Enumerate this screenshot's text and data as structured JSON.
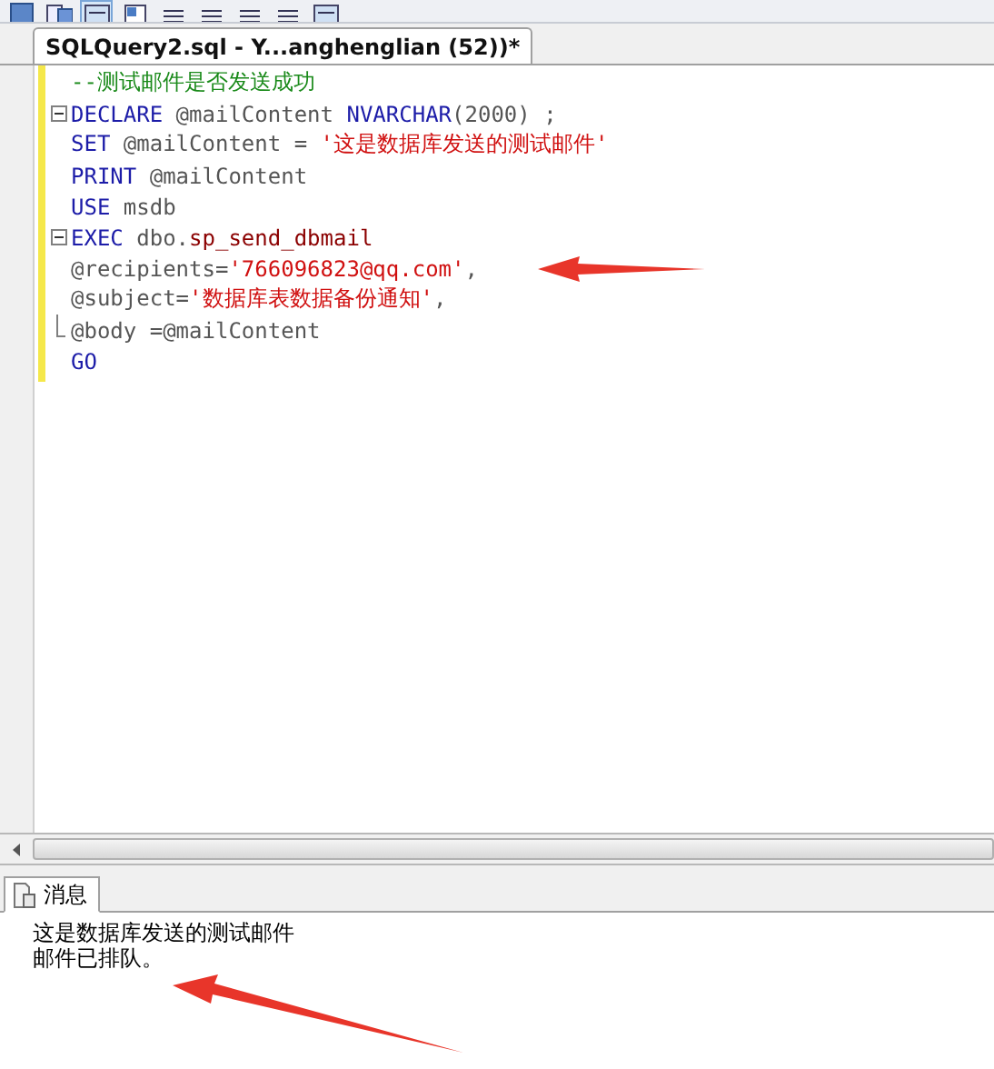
{
  "document_tab": {
    "title": "SQLQuery2.sql - Y...anghenglian (52))*",
    "selected": true
  },
  "editor": {
    "lines": [
      {
        "fold_start": false,
        "fold_end": false,
        "tokens": [
          {
            "kind": "comment",
            "text": "--测试邮件是否发送成功"
          }
        ]
      },
      {
        "fold_start": true,
        "fold_end": false,
        "tokens": [
          {
            "kind": "keyword",
            "text": "DECLARE"
          },
          {
            "kind": "plain",
            "text": " @mailContent "
          },
          {
            "kind": "keyword",
            "text": "NVARCHAR"
          },
          {
            "kind": "plain",
            "text": "(2000) ;"
          }
        ]
      },
      {
        "fold_start": false,
        "fold_end": false,
        "tokens": [
          {
            "kind": "keyword",
            "text": "SET"
          },
          {
            "kind": "plain",
            "text": " @mailContent = "
          },
          {
            "kind": "string",
            "text": "'这是数据库发送的测试邮件'"
          }
        ]
      },
      {
        "fold_start": false,
        "fold_end": false,
        "tokens": [
          {
            "kind": "keyword",
            "text": "PRINT"
          },
          {
            "kind": "plain",
            "text": " @mailContent"
          }
        ]
      },
      {
        "fold_start": false,
        "fold_end": false,
        "tokens": [
          {
            "kind": "keyword",
            "text": "USE"
          },
          {
            "kind": "plain",
            "text": " msdb"
          }
        ]
      },
      {
        "fold_start": true,
        "fold_end": false,
        "tokens": [
          {
            "kind": "keyword",
            "text": "EXEC"
          },
          {
            "kind": "plain",
            "text": " dbo."
          },
          {
            "kind": "sysproc",
            "text": "sp_send_dbmail"
          }
        ]
      },
      {
        "fold_start": false,
        "fold_end": false,
        "tokens": [
          {
            "kind": "plain",
            "text": "@recipients="
          },
          {
            "kind": "string",
            "text": "'766096823@qq.com'"
          },
          {
            "kind": "plain",
            "text": ","
          }
        ]
      },
      {
        "fold_start": false,
        "fold_end": false,
        "tokens": [
          {
            "kind": "plain",
            "text": "@subject="
          },
          {
            "kind": "string",
            "text": "'数据库表数据备份通知'"
          },
          {
            "kind": "plain",
            "text": ","
          }
        ]
      },
      {
        "fold_start": false,
        "fold_end": true,
        "tokens": [
          {
            "kind": "plain",
            "text": "@body =@mailContent"
          }
        ]
      },
      {
        "fold_start": false,
        "fold_end": false,
        "tokens": [
          {
            "kind": "keyword",
            "text": "GO"
          }
        ]
      }
    ]
  },
  "results": {
    "tabs": [
      {
        "label": "消息",
        "selected": true
      }
    ],
    "messages": [
      "这是数据库发送的测试邮件",
      "邮件已排队。"
    ]
  }
}
